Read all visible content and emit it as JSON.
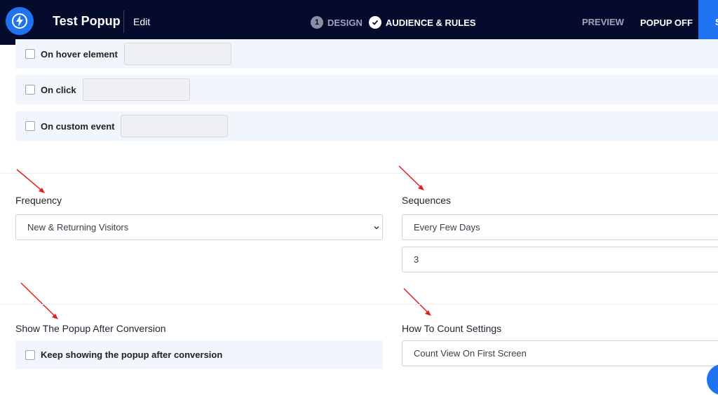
{
  "header": {
    "app_title": "Test Popup",
    "edit_label": "Edit",
    "steps": [
      {
        "number": "1",
        "label": "DESIGN"
      },
      {
        "label": "AUDIENCE & RULES"
      }
    ],
    "preview_label": "PREVIEW",
    "popup_off_label": "POPUP OFF",
    "save_label": "S"
  },
  "triggers": [
    {
      "label": "On hover element",
      "value": ""
    },
    {
      "label": "On click",
      "value": ""
    },
    {
      "label": "On custom event",
      "value": ""
    }
  ],
  "frequency": {
    "title": "Frequency",
    "selected": "New & Returning Visitors"
  },
  "sequences": {
    "title": "Sequences",
    "selected": "Every Few Days",
    "days_value": "3"
  },
  "after_conversion": {
    "title": "Show The Popup After Conversion",
    "keep_showing_label": "Keep showing the popup after conversion"
  },
  "count_settings": {
    "title": "How To Count Settings",
    "selected": "Count View On First Screen"
  },
  "colors": {
    "header_bg": "#050b2c",
    "accent": "#1f73f1",
    "row_bg": "#f1f6fc",
    "annotation_arrow": "#e02020"
  }
}
